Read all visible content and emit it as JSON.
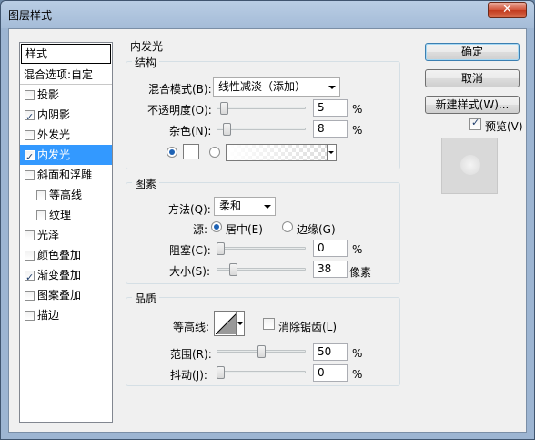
{
  "window": {
    "title": "图层样式",
    "close_label": "✕"
  },
  "sidebar": {
    "header": "样式",
    "blend_options": "混合选项:自定",
    "items": [
      {
        "label": "投影",
        "checked": false,
        "sub": false,
        "selected": false
      },
      {
        "label": "内阴影",
        "checked": true,
        "sub": false,
        "selected": false
      },
      {
        "label": "外发光",
        "checked": false,
        "sub": false,
        "selected": false
      },
      {
        "label": "内发光",
        "checked": true,
        "sub": false,
        "selected": true
      },
      {
        "label": "斜面和浮雕",
        "checked": false,
        "sub": false,
        "selected": false
      },
      {
        "label": "等高线",
        "checked": false,
        "sub": true,
        "selected": false
      },
      {
        "label": "纹理",
        "checked": false,
        "sub": true,
        "selected": false
      },
      {
        "label": "光泽",
        "checked": false,
        "sub": false,
        "selected": false
      },
      {
        "label": "颜色叠加",
        "checked": false,
        "sub": false,
        "selected": false
      },
      {
        "label": "渐变叠加",
        "checked": true,
        "sub": false,
        "selected": false
      },
      {
        "label": "图案叠加",
        "checked": false,
        "sub": false,
        "selected": false
      },
      {
        "label": "描边",
        "checked": false,
        "sub": false,
        "selected": false
      }
    ]
  },
  "panel": {
    "title": "内发光",
    "structure": {
      "label": "结构",
      "blend_mode_label": "混合模式(B):",
      "blend_mode_value": "线性减淡（添加）",
      "opacity_label": "不透明度(O):",
      "opacity_value": "5",
      "opacity_fraction": 0.05,
      "noise_label": "杂色(N):",
      "noise_value": "8",
      "noise_fraction": 0.08,
      "percent": "%"
    },
    "elements": {
      "label": "图素",
      "method_label": "方法(Q):",
      "method_value": "柔和",
      "source_label": "源:",
      "source_center": "居中(E)",
      "source_edge": "边缘(G)",
      "choke_label": "阻塞(C):",
      "choke_value": "0",
      "choke_fraction": 0.0,
      "size_label": "大小(S):",
      "size_value": "38",
      "size_fraction": 0.152,
      "size_unit": "像素",
      "percent": "%"
    },
    "quality": {
      "label": "品质",
      "contour_label": "等高线:",
      "antialias_label": "消除锯齿(L)",
      "range_label": "范围(R):",
      "range_value": "50",
      "range_fraction": 0.5,
      "jitter_label": "抖动(J):",
      "jitter_value": "0",
      "jitter_fraction": 0.0,
      "percent": "%"
    }
  },
  "buttons": {
    "ok": "确定",
    "cancel": "取消",
    "new_style": "新建样式(W)...",
    "preview_label": "预览(V)"
  },
  "colors": {
    "selected": "#3399ff",
    "close": "#c23a1d"
  }
}
